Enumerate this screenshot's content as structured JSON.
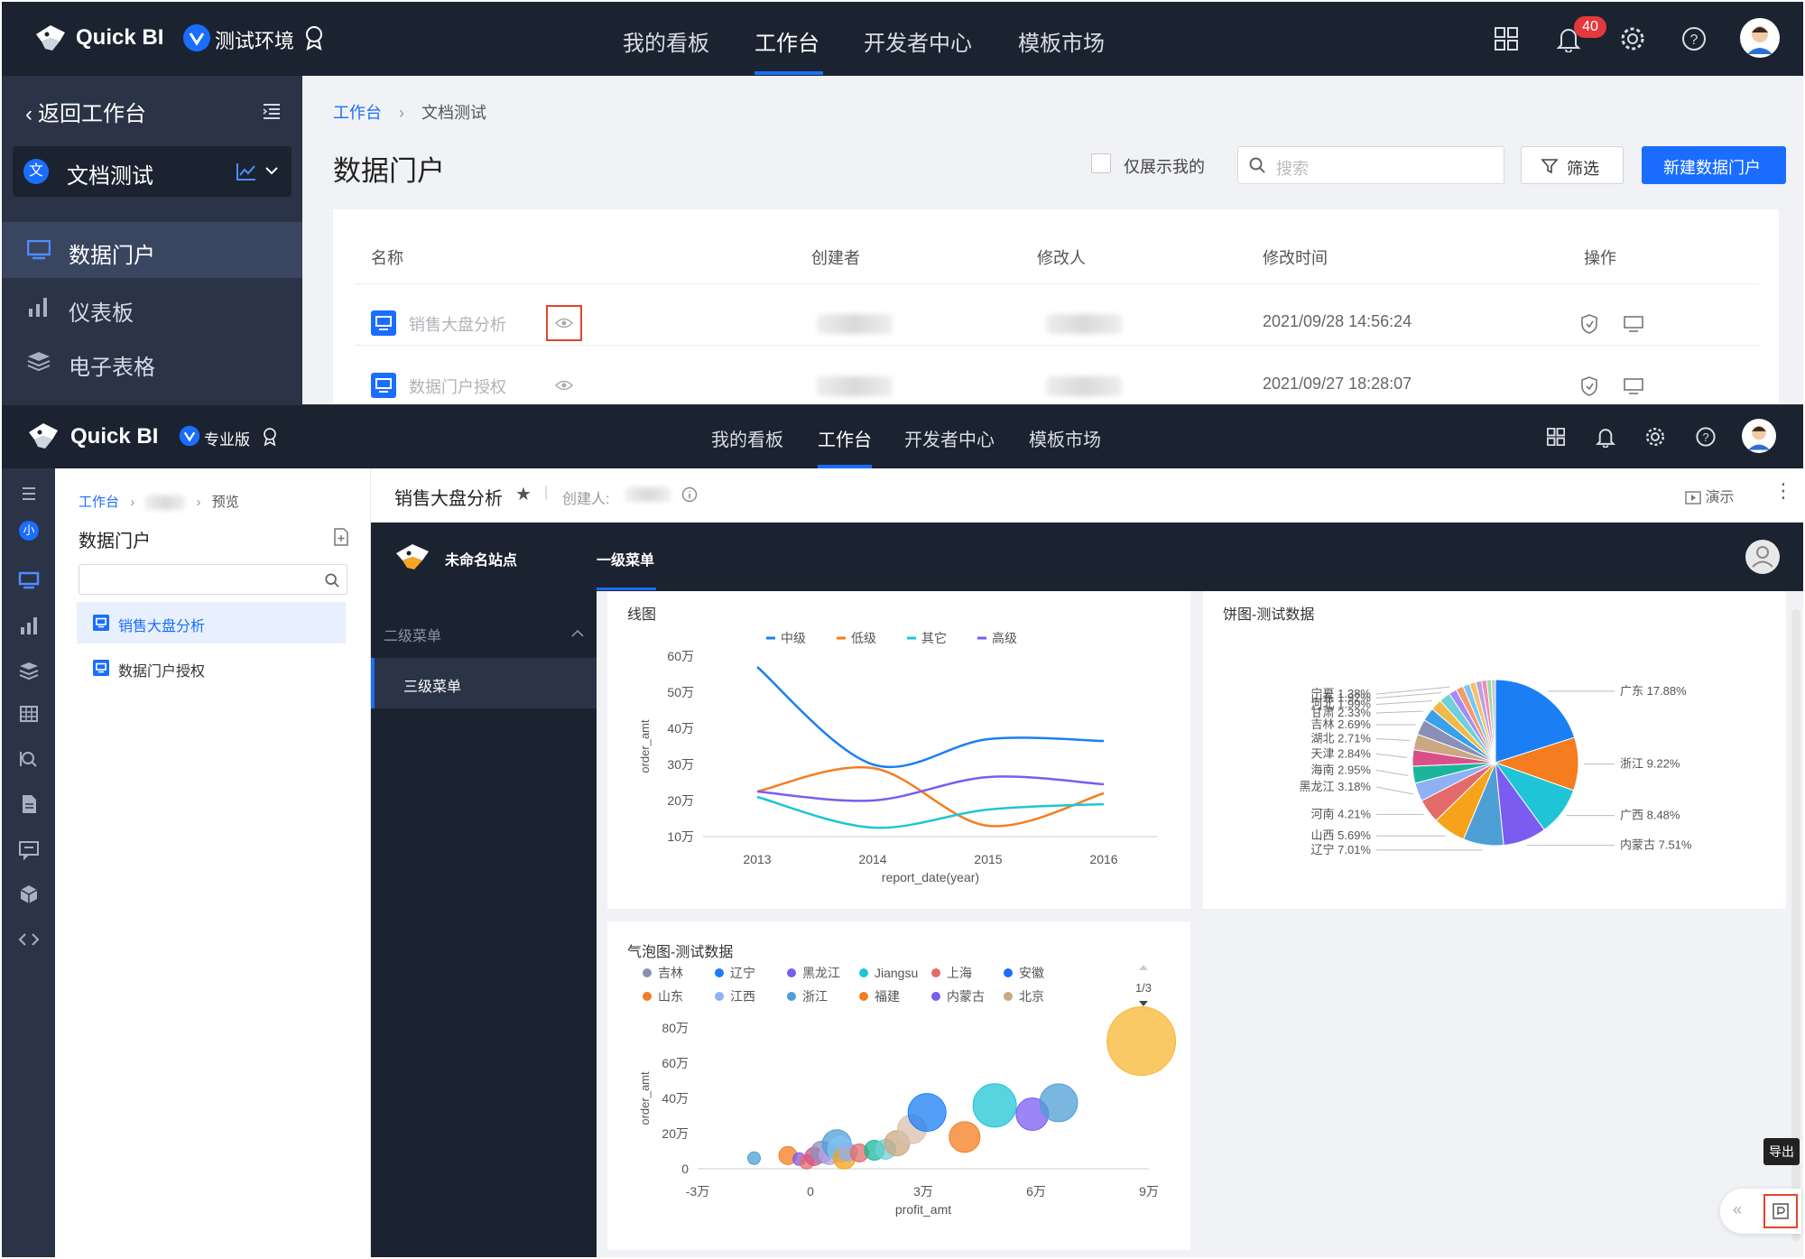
{
  "brand": {
    "name": "Quick BI"
  },
  "frame1": {
    "env_label": "测试环境",
    "nav": [
      "我的看板",
      "工作台",
      "开发者中心",
      "模板市场"
    ],
    "notif_count": "40",
    "back_label": "返回工作台",
    "workspace": {
      "badge": "文",
      "name": "文档测试"
    },
    "sidebar": [
      {
        "label": "数据门户",
        "icon": "portal-icon"
      },
      {
        "label": "仪表板",
        "icon": "dashboard-icon"
      },
      {
        "label": "电子表格",
        "icon": "spreadsheet-icon"
      }
    ],
    "breadcrumb": {
      "root": "工作台",
      "current": "文档测试"
    },
    "title": "数据门户",
    "only_mine": "仅展示我的",
    "search_placeholder": "搜索",
    "filter_label": "筛选",
    "new_button": "新建数据门户",
    "columns": [
      "名称",
      "创建者",
      "修改人",
      "修改时间",
      "操作"
    ],
    "rows": [
      {
        "name": "销售大盘分析",
        "time": "2021/09/28 14:56:24"
      },
      {
        "name": "数据门户授权",
        "time": "2021/09/27 18:28:07"
      }
    ]
  },
  "frame2": {
    "edition_label": "专业版",
    "nav": [
      "我的看板",
      "工作台",
      "开发者中心",
      "模板市场"
    ],
    "rail_badge": "小",
    "breadcrumb": {
      "root": "工作台",
      "current": "预览"
    },
    "tree_title": "数据门户",
    "tree_items": [
      "销售大盘分析",
      "数据门户授权"
    ],
    "report_title": "销售大盘分析",
    "creator_label": "创建人:",
    "present_label": "演示",
    "site_name": "未命名站点",
    "menu1": "一级菜单",
    "menu2": "二级菜单",
    "menu3": "三级菜单",
    "export_tooltip": "导出"
  },
  "chart_data": [
    {
      "type": "line",
      "title": "线图",
      "xlabel": "report_date(year)",
      "ylabel": "order_amt",
      "categories": [
        "2013",
        "2014",
        "2015",
        "2016"
      ],
      "y_ticks": [
        "10万",
        "20万",
        "30万",
        "40万",
        "50万",
        "60万"
      ],
      "ylim": [
        100000,
        600000
      ],
      "series": [
        {
          "name": "中级",
          "color": "#1a7ff5",
          "values": [
            570000,
            300000,
            370000,
            365000
          ]
        },
        {
          "name": "低级",
          "color": "#f57c1f",
          "values": [
            225000,
            290000,
            130000,
            220000
          ]
        },
        {
          "name": "其它",
          "color": "#1fc5d6",
          "values": [
            210000,
            125000,
            175000,
            190000
          ]
        },
        {
          "name": "高级",
          "color": "#7b5cf0",
          "values": [
            225000,
            200000,
            265000,
            245000
          ]
        }
      ]
    },
    {
      "type": "pie",
      "title": "饼图-测试数据",
      "slices": [
        {
          "label": "广东",
          "value": 17.88,
          "color": "#1a7ff5"
        },
        {
          "label": "浙江",
          "value": 9.22,
          "color": "#f57c1f"
        },
        {
          "label": "广西",
          "value": 8.48,
          "color": "#1fc5d6"
        },
        {
          "label": "内蒙古",
          "value": 7.51,
          "color": "#7b5cf0"
        },
        {
          "label": "辽宁",
          "value": 7.01,
          "color": "#4e9fd6"
        },
        {
          "label": "山西",
          "value": 5.69,
          "color": "#f7a21b"
        },
        {
          "label": "河南",
          "value": 4.21,
          "color": "#e56b6b"
        },
        {
          "label": "黑龙江",
          "value": 3.18,
          "color": "#8fb0f2"
        },
        {
          "label": "海南",
          "value": 2.95,
          "color": "#1bb59b"
        },
        {
          "label": "天津",
          "value": 2.84,
          "color": "#d94f8a"
        },
        {
          "label": "湖北",
          "value": 2.71,
          "color": "#c9a882"
        },
        {
          "label": "吉林",
          "value": 2.69,
          "color": "#8a8fb5"
        },
        {
          "label": "甘肃",
          "value": 2.33,
          "color": "#3aa0e8"
        },
        {
          "label": "河北",
          "value": 1.99,
          "color": "#f0b94a"
        },
        {
          "label": "山东",
          "value": 1.92,
          "color": "#6fd0d8"
        },
        {
          "label": "宁夏",
          "value": 1.38,
          "color": "#a78bf5"
        },
        {
          "label": "",
          "value": 1.3,
          "color": "#f29a6b"
        },
        {
          "label": "",
          "value": 1.2,
          "color": "#7ec4f2"
        },
        {
          "label": "",
          "value": 1.1,
          "color": "#f5c26b"
        },
        {
          "label": "",
          "value": 1.0,
          "color": "#b6a0e8"
        },
        {
          "label": "",
          "value": 0.9,
          "color": "#f08fb0"
        },
        {
          "label": "",
          "value": 0.8,
          "color": "#9fd8a5"
        },
        {
          "label": "",
          "value": 0.7,
          "color": "#c2c8d6"
        }
      ]
    },
    {
      "type": "scatter",
      "title": "气泡图-测试数据",
      "xlabel": "profit_amt",
      "ylabel": "order_amt",
      "x_ticks": [
        "-3万",
        "0",
        "3万",
        "6万",
        "9万"
      ],
      "y_ticks": [
        "0",
        "20万",
        "40万",
        "60万",
        "80万"
      ],
      "xlim": [
        -30000,
        90000
      ],
      "ylim": [
        0,
        800000
      ],
      "legend_page": "1/3",
      "legend": [
        {
          "name": "吉林",
          "color": "#8a8fb5"
        },
        {
          "name": "辽宁",
          "color": "#1a7ff5"
        },
        {
          "name": "黑龙江",
          "color": "#7b5cf0"
        },
        {
          "name": "Jiangsu",
          "color": "#1fc5d6"
        },
        {
          "name": "上海",
          "color": "#e56b6b"
        },
        {
          "name": "安徽",
          "color": "#1a6dff"
        },
        {
          "name": "山东",
          "color": "#f57c1f"
        },
        {
          "name": "江西",
          "color": "#8fb0f2"
        },
        {
          "name": "浙江",
          "color": "#4e9fd6"
        },
        {
          "name": "福建",
          "color": "#f57c1f"
        },
        {
          "name": "内蒙古",
          "color": "#7b5cf0"
        },
        {
          "name": "北京",
          "color": "#c9a882"
        }
      ],
      "points": [
        {
          "x": -15000,
          "y": 60000,
          "r": 7,
          "color": "#4e9fd6"
        },
        {
          "x": -6000,
          "y": 75000,
          "r": 10,
          "color": "#f57c1f"
        },
        {
          "x": -3000,
          "y": 55000,
          "r": 7,
          "color": "#7b5cf0"
        },
        {
          "x": -1000,
          "y": 40000,
          "r": 8,
          "color": "#e56b6b"
        },
        {
          "x": 1000,
          "y": 70000,
          "r": 10,
          "color": "#d94f8a"
        },
        {
          "x": 3000,
          "y": 95000,
          "r": 12,
          "color": "#8a8fb5"
        },
        {
          "x": 5000,
          "y": 80000,
          "r": 11,
          "color": "#b6a0e8"
        },
        {
          "x": 7000,
          "y": 140000,
          "r": 16,
          "color": "#4e9fd6"
        },
        {
          "x": 8000,
          "y": 110000,
          "r": 14,
          "color": "#7ec4f2"
        },
        {
          "x": 9000,
          "y": 60000,
          "r": 12,
          "color": "#f7a21b"
        },
        {
          "x": 10000,
          "y": 95000,
          "r": 10,
          "color": "#8fb0f2"
        },
        {
          "x": 13000,
          "y": 90000,
          "r": 10,
          "color": "#e56b6b"
        },
        {
          "x": 17000,
          "y": 105000,
          "r": 11,
          "color": "#1bb59b"
        },
        {
          "x": 20000,
          "y": 110000,
          "r": 11,
          "color": "#6fd0d8"
        },
        {
          "x": 23000,
          "y": 145000,
          "r": 14,
          "color": "#c9a882"
        },
        {
          "x": 27000,
          "y": 225000,
          "r": 16,
          "color": "#d8c0ad"
        },
        {
          "x": 31000,
          "y": 320000,
          "r": 21,
          "color": "#1a7ff5"
        },
        {
          "x": 41000,
          "y": 180000,
          "r": 17,
          "color": "#f57c1f"
        },
        {
          "x": 49000,
          "y": 360000,
          "r": 24,
          "color": "#1fc5d6"
        },
        {
          "x": 59000,
          "y": 310000,
          "r": 18,
          "color": "#7b5cf0"
        },
        {
          "x": 66000,
          "y": 375000,
          "r": 21,
          "color": "#4e9fd6"
        },
        {
          "x": 88000,
          "y": 725000,
          "r": 38,
          "color": "#f7b733"
        }
      ]
    }
  ]
}
